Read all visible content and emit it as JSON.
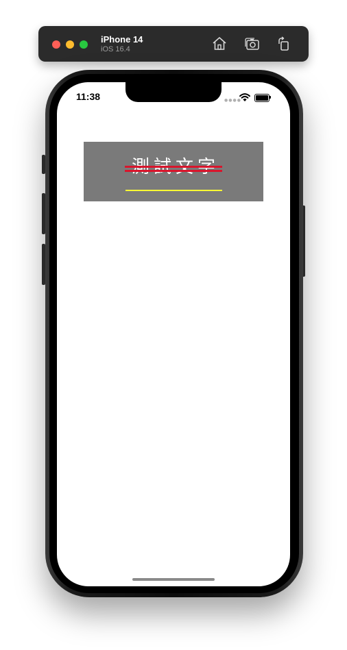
{
  "simulator": {
    "device_name": "iPhone 14",
    "os_version": "iOS 16.4",
    "controls": [
      "home-icon",
      "screenshot-icon",
      "rotate-icon"
    ],
    "traffic_lights": {
      "close": "#ff5f57",
      "minimize": "#febc2e",
      "zoom": "#28c840"
    }
  },
  "status_bar": {
    "time": "11:38",
    "icons": [
      "signal-icon",
      "wifi-icon",
      "battery-icon"
    ]
  },
  "content": {
    "label_text": "測試文字",
    "label_background": "#7a7a7a",
    "text_color": "#ffffff",
    "strikethrough_color": "#d9152c",
    "underline_color": "#ffff33"
  }
}
